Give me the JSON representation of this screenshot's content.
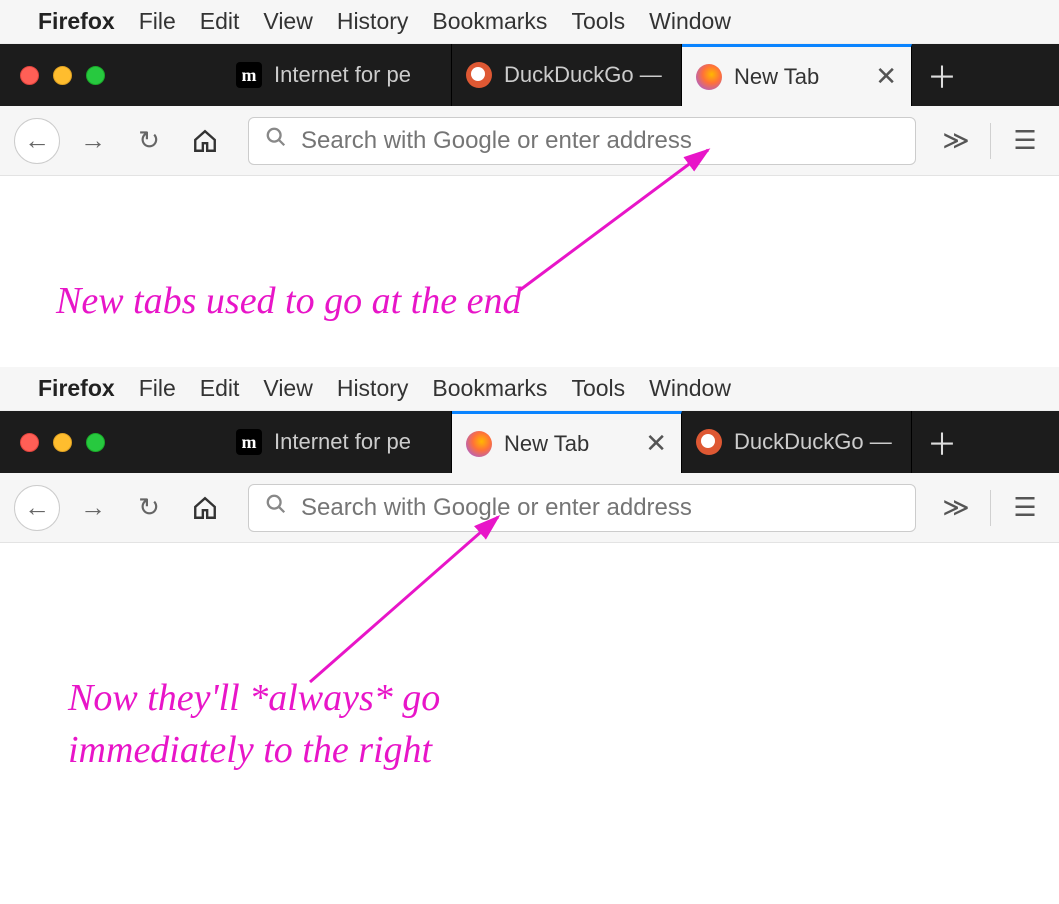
{
  "menubar": {
    "app": "Firefox",
    "items": [
      "File",
      "Edit",
      "View",
      "History",
      "Bookmarks",
      "Tools",
      "Window"
    ]
  },
  "screenshot1": {
    "tabs": [
      {
        "label": "Internet for pe",
        "favicon": "m"
      },
      {
        "label": "DuckDuckGo —",
        "favicon": "duck"
      },
      {
        "label": "New Tab",
        "favicon": "ff",
        "active": true
      }
    ],
    "url_placeholder": "Search with Google or enter address"
  },
  "screenshot2": {
    "tabs": [
      {
        "label": "Internet for pe",
        "favicon": "m"
      },
      {
        "label": "New Tab",
        "favicon": "ff",
        "active": true
      },
      {
        "label": "DuckDuckGo —",
        "favicon": "duck"
      }
    ],
    "url_placeholder": "Search with Google or enter address"
  },
  "annotations": {
    "top": "New tabs used to go at the end",
    "bottom_l1": "Now they'll  *always* go",
    "bottom_l2": "immediately to the right"
  }
}
